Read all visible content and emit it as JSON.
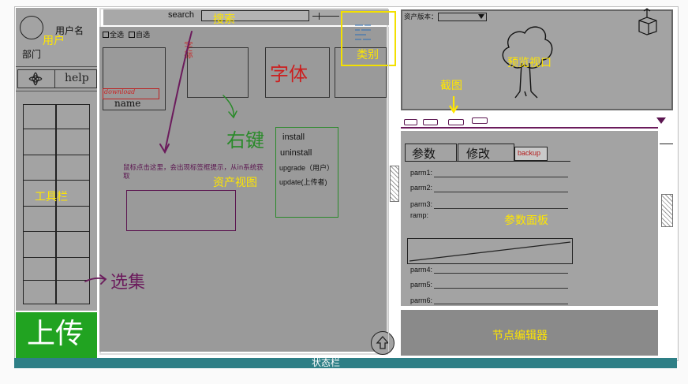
{
  "colors": {
    "annotation": "#ffe600",
    "upload_green": "#21a321",
    "status_bar": "#2e7f86",
    "panel_gray": "#9a9a9a",
    "node_gray": "#8a8a8a",
    "hand_red": "#cc1f1f",
    "hand_green": "#2a8a2a",
    "hand_purple": "#6b1b5c",
    "selection_yellow": "#f3e000"
  },
  "left_panel": {
    "username": "用户名",
    "department": "部门",
    "user_annotation": "用户",
    "help_label": "help",
    "toolbar_annotation": "工具栏",
    "upload_label": "上传",
    "avatar_icon": "avatar-circle",
    "settings_icon": "gear-flower-icon"
  },
  "asset_panel": {
    "search_label": "search",
    "search_annotation": "搜索",
    "category_annotation": "类别",
    "checkbox_1": "全选",
    "checkbox_2": "自选",
    "asset_name": "name",
    "download_label": "download",
    "assets_view_annotation": "资产视图",
    "hand_red_1": "字体",
    "hand_red_2": "字标",
    "hand_green": "右键",
    "hand_purple": "选集",
    "menu": [
      "install",
      "uninstall",
      "upgrade（用户）",
      "update(上传者)"
    ],
    "tooltip_note": "鼠标点击这里，会出现标签框提示，从in系统获取"
  },
  "right_panel": {
    "version_label": "资产版本：",
    "preview_annotation": "预览视口",
    "screenshot_annotation": "截图",
    "tab_1": "参数",
    "tab_2": "修改",
    "tab_backup": "backup",
    "params_annotation": "参数面板",
    "params_top": [
      "parm1:",
      "parm2:",
      "parm3:",
      "ramp:"
    ],
    "params_bottom": [
      "parm4:",
      "parm5:",
      "parm6:"
    ],
    "node_editor_annotation": "节点编辑器"
  },
  "status_bar": {
    "label": "状态栏"
  }
}
